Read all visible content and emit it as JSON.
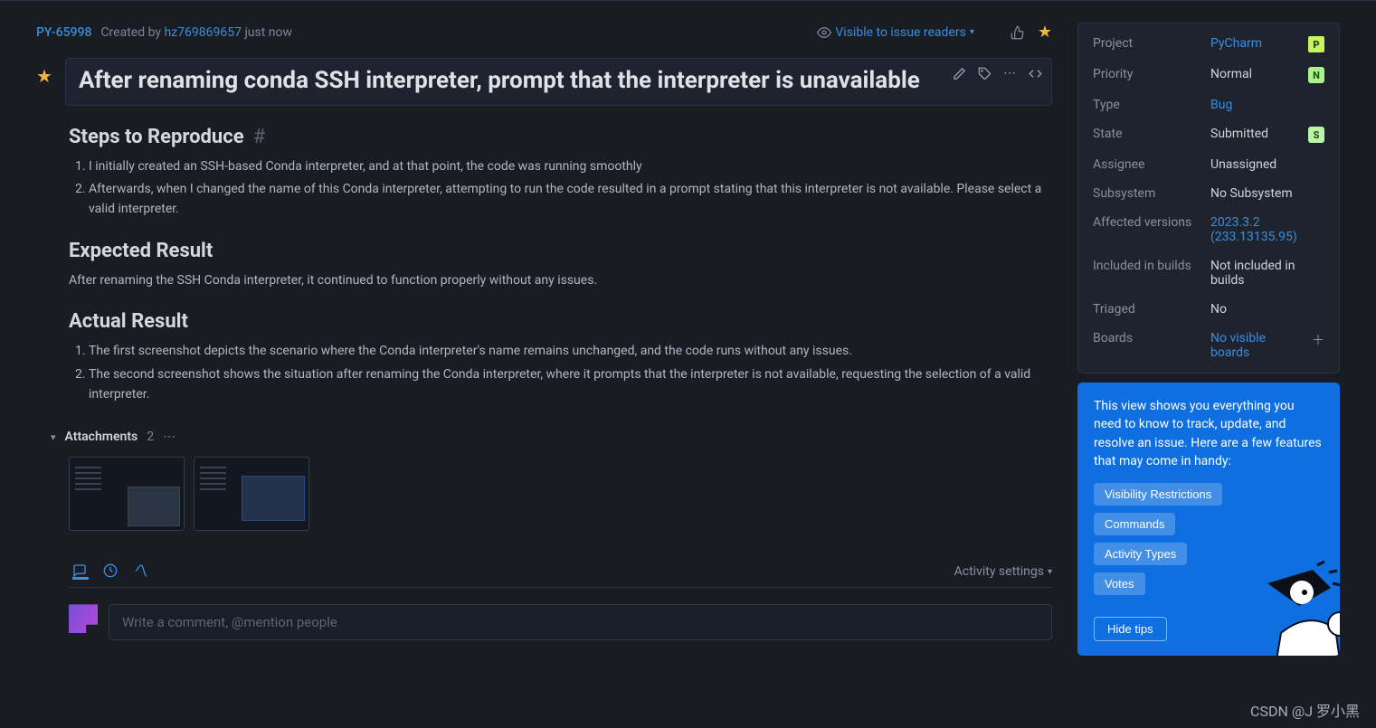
{
  "header": {
    "issue_id": "PY-65998",
    "created_pre": "Created by",
    "username": "hz769869657",
    "created_post": "just now",
    "visibility": "Visible to issue readers"
  },
  "title": "After renaming conda SSH interpreter, prompt that the interpreter is unavailable",
  "sections": {
    "steps_heading": "Steps to Reproduce",
    "steps": [
      "I initially created an SSH-based Conda interpreter, and at that point, the code was running smoothly",
      "Afterwards, when I changed the name of this Conda interpreter, attempting to run the code resulted in a prompt stating that this interpreter is not available. Please select a valid interpreter."
    ],
    "expected_heading": "Expected Result",
    "expected_body": "After renaming the SSH Conda interpreter, it continued to function properly without any issues.",
    "actual_heading": "Actual Result",
    "actual": [
      "The first screenshot depicts the scenario where the Conda interpreter's name remains unchanged, and the code runs without any issues.",
      "The second screenshot shows the situation after renaming the Conda interpreter, where it prompts that the interpreter is not available, requesting the selection of a valid interpreter."
    ]
  },
  "attachments": {
    "label": "Attachments",
    "count": "2"
  },
  "activity_settings": "Activity settings",
  "comment_placeholder": "Write a comment, @mention people",
  "fields": {
    "project": {
      "label": "Project",
      "value": "PyCharm"
    },
    "priority": {
      "label": "Priority",
      "value": "Normal"
    },
    "type": {
      "label": "Type",
      "value": "Bug"
    },
    "state": {
      "label": "State",
      "value": "Submitted"
    },
    "assignee": {
      "label": "Assignee",
      "value": "Unassigned"
    },
    "subsystem": {
      "label": "Subsystem",
      "value": "No Subsystem"
    },
    "affected": {
      "label": "Affected versions",
      "value": "2023.3.2 (233.13135.95)"
    },
    "included": {
      "label": "Included in builds",
      "value": "Not included in builds"
    },
    "triaged": {
      "label": "Triaged",
      "value": "No"
    },
    "boards": {
      "label": "Boards",
      "value": "No visible boards"
    }
  },
  "tips": {
    "text": "This view shows you everything you need to know to track, update, and resolve an issue. Here are a few features that may come in handy:",
    "tags": [
      "Visibility Restrictions",
      "Commands",
      "Activity Types",
      "Votes"
    ],
    "hide": "Hide tips"
  },
  "watermark": "CSDN @J 罗小黑"
}
